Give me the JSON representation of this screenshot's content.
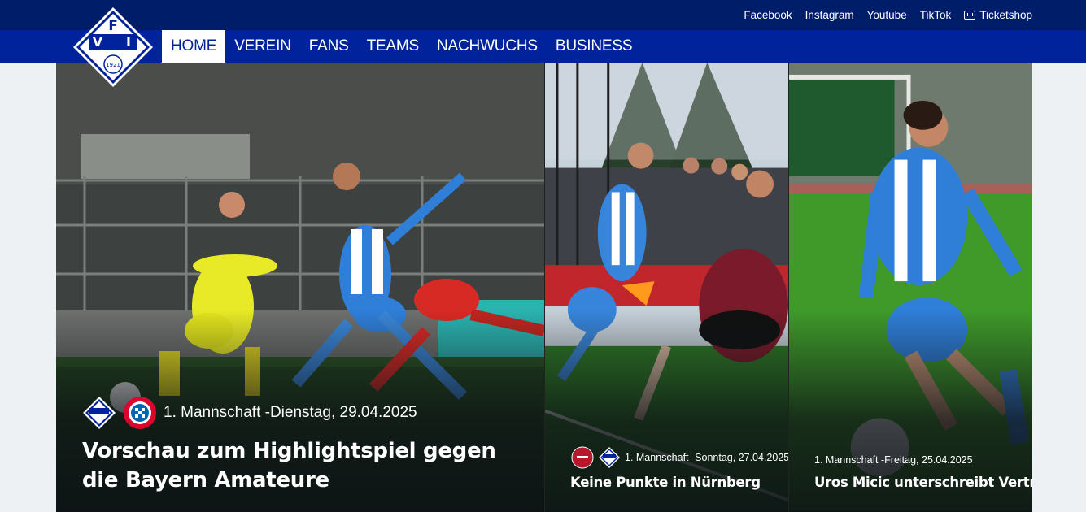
{
  "social": [
    {
      "label": "Facebook"
    },
    {
      "label": "Instagram"
    },
    {
      "label": "Youtube"
    },
    {
      "label": "TikTok"
    },
    {
      "label": "Ticketshop",
      "icon": "ticket-icon"
    }
  ],
  "nav": [
    {
      "label": "HOME",
      "active": true
    },
    {
      "label": "VEREIN"
    },
    {
      "label": "FANS"
    },
    {
      "label": "TEAMS"
    },
    {
      "label": "NACHWUCHS"
    },
    {
      "label": "BUSINESS"
    }
  ],
  "logo": {
    "top": "F",
    "left": "V",
    "right": "I",
    "year": "1921"
  },
  "news": [
    {
      "meta": "1. Mannschaft -Dienstag, 29.04.2025",
      "title": "Vorschau zum Highlightspiel gegen die Bayern Amateure",
      "badges": [
        "fvi-logo",
        "fc-bayern-logo"
      ]
    },
    {
      "meta": "1. Mannschaft -Sonntag, 27.04.2025",
      "title": "Keine Punkte in Nürnberg",
      "badges": [
        "1fcn-logo",
        "fvi-logo"
      ]
    },
    {
      "meta": "1. Mannschaft -Freitag, 25.04.2025",
      "title": "Uros Micic unterschreibt Vertrag f",
      "badges": []
    }
  ],
  "colors": {
    "topbar": "#001d6a",
    "navbar": "#00229a",
    "accent": "#3a86d8",
    "page": "#eef1f4"
  }
}
